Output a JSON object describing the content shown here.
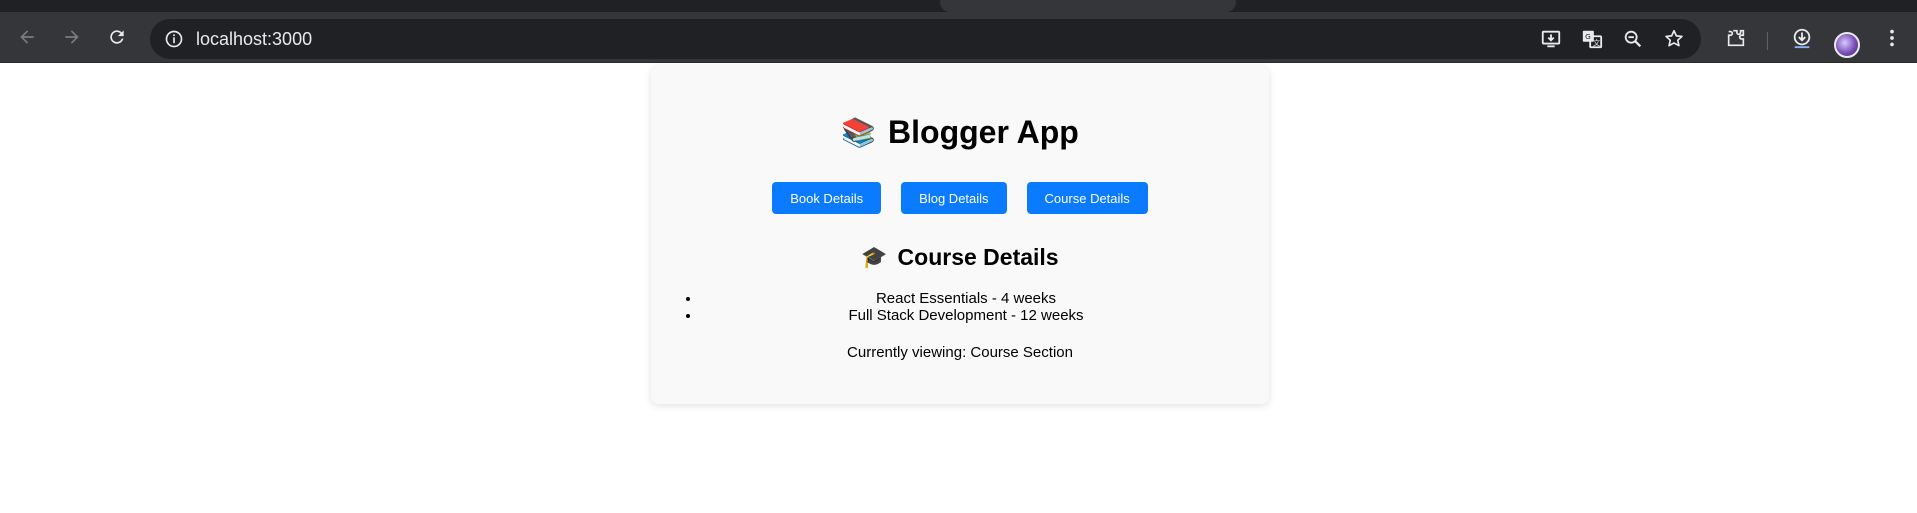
{
  "browser": {
    "url": "localhost:3000",
    "colors": {
      "chrome_bg": "#35363a",
      "omnibox_bg": "#202124",
      "icon": "#e8eaed"
    },
    "icons": [
      "back-arrow-icon",
      "forward-arrow-icon",
      "reload-icon",
      "site-info-icon",
      "install-app-icon",
      "translate-icon",
      "zoom-icon",
      "bookmark-star-icon",
      "extensions-icon",
      "download-icon",
      "profile-avatar",
      "more-menu-icon"
    ]
  },
  "page": {
    "title_icon": "📚",
    "title": "Blogger App",
    "buttons": [
      {
        "label": "Book Details"
      },
      {
        "label": "Blog Details"
      },
      {
        "label": "Course Details"
      }
    ],
    "section": {
      "icon": "🎓",
      "title": "Course Details",
      "courses": [
        "React Essentials - 4 weeks",
        "Full Stack Development - 12 weeks"
      ]
    },
    "status": "Currently viewing: Course Section",
    "colors": {
      "button_bg": "#0a7bff",
      "card_bg": "#f9f9f9"
    }
  }
}
